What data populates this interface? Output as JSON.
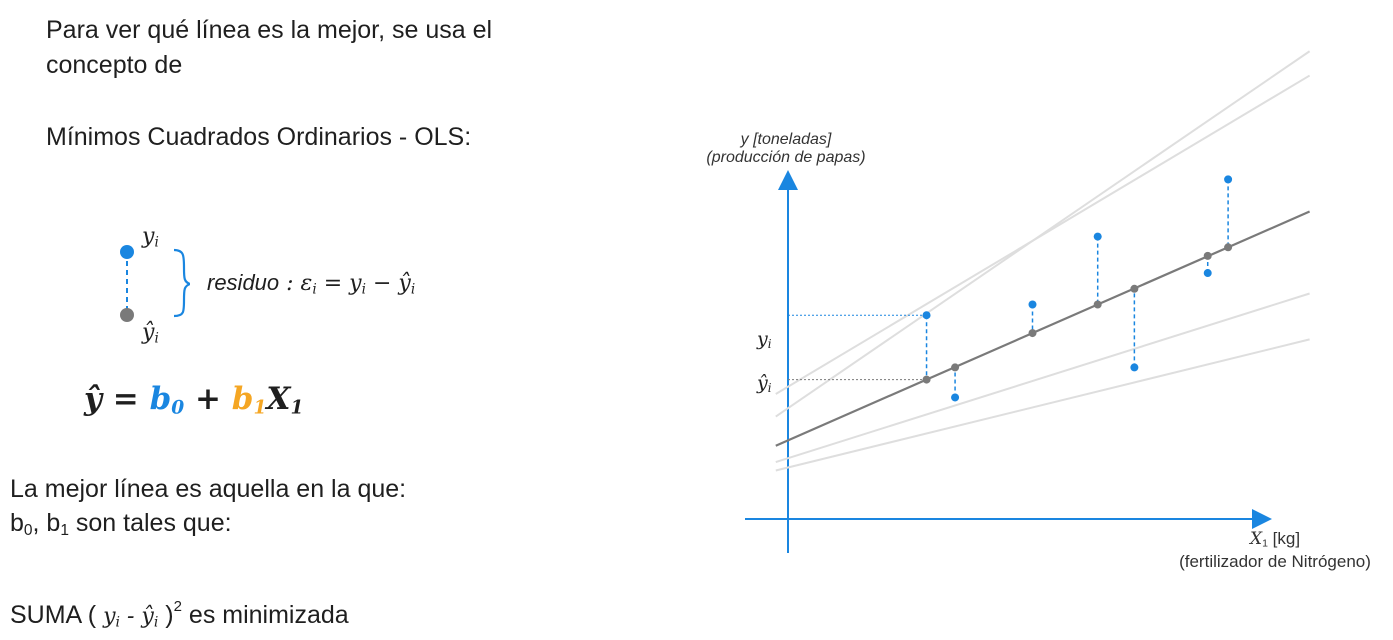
{
  "intro": {
    "line1": "Para ver qué línea es la mejor, se usa el",
    "line2": "concepto de",
    "method": "Mínimos Cuadrados Ordinarios - OLS:"
  },
  "residual_legend": {
    "y_label": "y",
    "y_sub": "i",
    "yhat_label": "ŷ",
    "yhat_sub": "i",
    "residuo_word": "residuo",
    "equation_prefix": " : ε",
    "eps_sub": "i",
    "equation_eq": " =  y",
    "eq_y_sub": "i",
    "equation_minus": " − ŷ",
    "eq_yhat_sub": "i"
  },
  "formula": {
    "lhs": "ŷ",
    "eq": " = ",
    "b0": "b",
    "b0_sub": "0",
    "plus": " + ",
    "b1": "b",
    "b1_sub": "1",
    "x": "X",
    "x_sub": "1",
    "b0_color": "#1a86e0",
    "b1_color": "#f5a623"
  },
  "conclusion": {
    "line1": "La mejor línea es aquella en la que:",
    "b0": "b",
    "b0_sub": "0",
    "comma": ", b",
    "b1_sub": "1",
    "rest": " son tales que:",
    "suma": "SUMA ( ",
    "y": "y",
    "y_sub": "i",
    "minus": " - ŷ",
    "yhat_sub": "i",
    "close": " )",
    "exp": "2",
    "end": "  es minimizada"
  },
  "chart_labels": {
    "y_axis_line1": "y [toneladas]",
    "y_axis_line2": "(producción de papas)",
    "x_axis_var": "X",
    "x_axis_sub": "1",
    "x_axis_unit": " [kg]",
    "x_axis_desc": "(fertilizador de Nitrógeno)",
    "yi_tick": "y",
    "yi_sub": "i",
    "yhat_tick": "ŷ",
    "yhat_sub": "i"
  },
  "colors": {
    "observed": "#1a86e0",
    "predicted": "#7a7a7a",
    "fit_line": "#7a7a7a",
    "candidate_lines": "#dedede",
    "axis": "#1a86e0"
  },
  "chart_data": {
    "type": "scatter",
    "fit_line": {
      "intercept": 1.1,
      "slope": 0.5
    },
    "candidate_lines": [
      {
        "intercept": 1.55,
        "slope": 0.78
      },
      {
        "intercept": 1.85,
        "slope": 0.68
      },
      {
        "intercept": 0.85,
        "slope": 0.36
      },
      {
        "intercept": 0.72,
        "slope": 0.28
      }
    ],
    "points": [
      {
        "x": 1.7,
        "y": 2.85,
        "y_hat": 1.95
      },
      {
        "x": 2.05,
        "y": 1.7,
        "y_hat": 2.12
      },
      {
        "x": 3.0,
        "y": 3.0,
        "y_hat": 2.6
      },
      {
        "x": 3.8,
        "y": 3.95,
        "y_hat": 3.0
      },
      {
        "x": 4.25,
        "y": 2.12,
        "y_hat": 3.22
      },
      {
        "x": 5.15,
        "y": 3.44,
        "y_hat": 3.68
      },
      {
        "x": 5.4,
        "y": 4.75,
        "y_hat": 3.8
      }
    ],
    "xlim": [
      0,
      6.5
    ],
    "ylim": [
      0,
      5.5
    ]
  }
}
